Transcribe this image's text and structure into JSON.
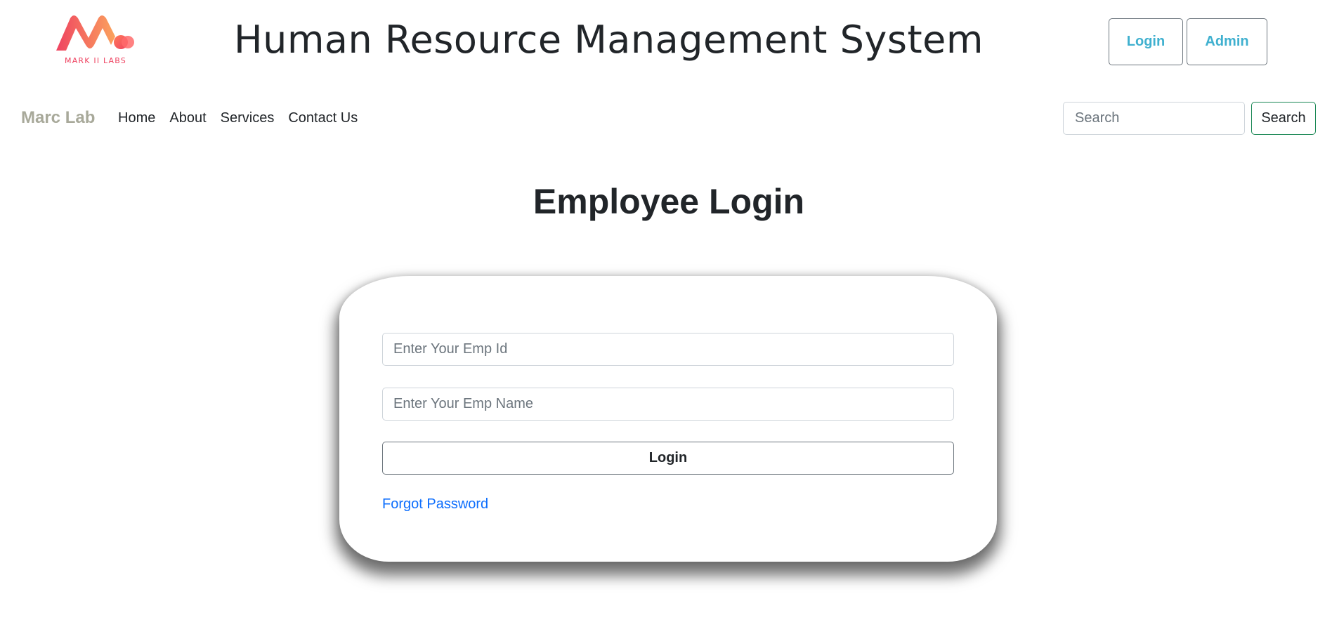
{
  "header": {
    "logo_text": "MARK II LABS",
    "title": "Human Resource Management System",
    "login_label": "Login",
    "admin_label": "Admin"
  },
  "navbar": {
    "brand": "Marc Lab",
    "links": [
      "Home",
      "About",
      "Services",
      "Contact Us"
    ],
    "search_placeholder": "Search",
    "search_button": "Search"
  },
  "main": {
    "title": "Employee Login",
    "emp_id_placeholder": "Enter Your Emp Id",
    "emp_name_placeholder": "Enter Your Emp Name",
    "login_button": "Login",
    "forgot_password": "Forgot Password"
  },
  "colors": {
    "accent": "#3fb0cf",
    "brand": "#a8a99a",
    "link": "#0d6efd",
    "search_border": "#198754",
    "logo_gradient_start": "#ef4361",
    "logo_gradient_end": "#fba35d"
  },
  "icons": {
    "logo": "mark-ii-labs-logo"
  }
}
